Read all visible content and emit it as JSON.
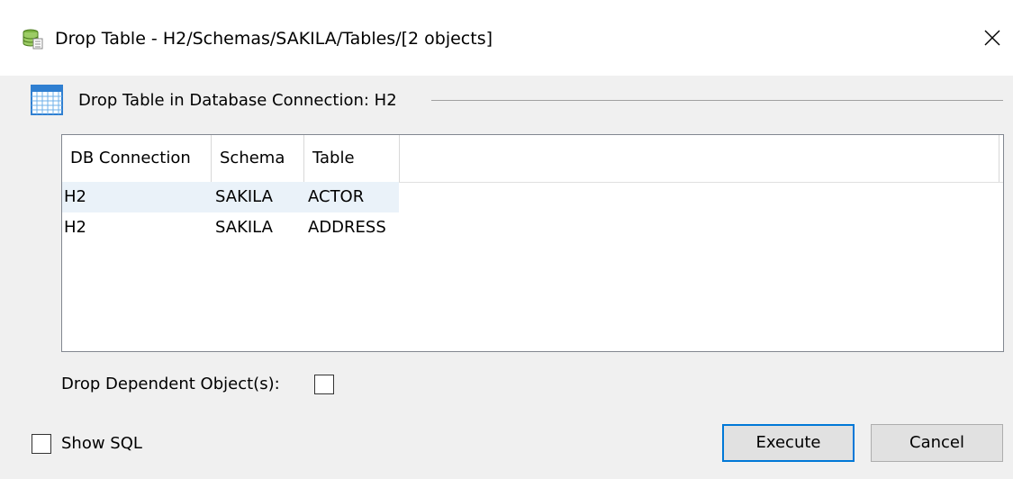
{
  "window": {
    "title": "Drop Table - H2/Schemas/SAKILA/Tables/[2 objects]",
    "app_icon": "database-icon",
    "close_icon": "close-icon"
  },
  "group": {
    "icon": "table-grid-icon",
    "label": "Drop Table in Database Connection: H2"
  },
  "table": {
    "columns": [
      "DB Connection",
      "Schema",
      "Table"
    ],
    "rows": [
      {
        "db": "H2",
        "schema": "SAKILA",
        "table": "ACTOR"
      },
      {
        "db": "H2",
        "schema": "SAKILA",
        "table": "ADDRESS"
      }
    ],
    "selected_row": 0
  },
  "options": {
    "drop_dependent_label": "Drop Dependent Object(s):",
    "drop_dependent_checked": false,
    "show_sql_label": "Show SQL",
    "show_sql_checked": false
  },
  "buttons": {
    "execute": "Execute",
    "cancel": "Cancel"
  },
  "colors": {
    "selection": "#eaf2f9",
    "primary_border": "#0078d7",
    "button_bg": "#e1e1e1"
  }
}
